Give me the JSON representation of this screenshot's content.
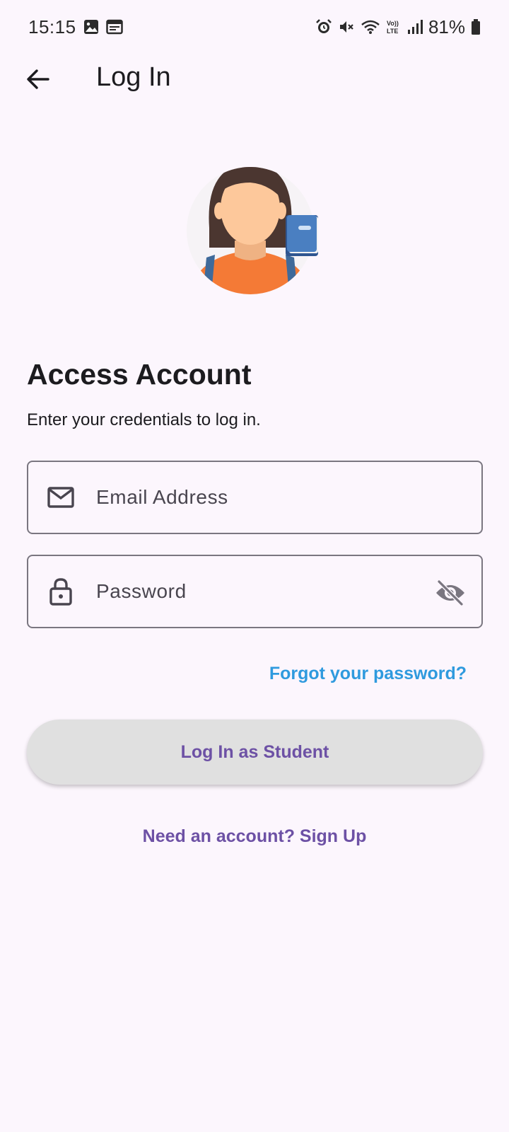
{
  "status_bar": {
    "time": "15:15",
    "battery": "81%",
    "icons": [
      "image-icon",
      "calendar-icon",
      "alarm-icon",
      "mute-icon",
      "wifi-icon",
      "volte-icon",
      "signal-icon",
      "battery-icon"
    ]
  },
  "app_bar": {
    "title": "Log In",
    "back_icon": "arrow-left-icon"
  },
  "content": {
    "heading": "Access Account",
    "subheading": "Enter your credentials to log in.",
    "email": {
      "placeholder": "Email Address",
      "value": "",
      "icon": "mail-icon"
    },
    "password": {
      "placeholder": "Password",
      "value": "",
      "icon": "lock-icon",
      "toggle_icon": "eye-off-icon"
    },
    "forgot_link": "Forgot your password?",
    "login_button": "Log In as Student",
    "signup_link": "Need an account? Sign Up"
  },
  "colors": {
    "background": "#fcf6fd",
    "accent_purple": "#6d51a5",
    "link_blue": "#2f9ade",
    "button_bg": "#e0e0e0",
    "border": "#7a7680"
  }
}
